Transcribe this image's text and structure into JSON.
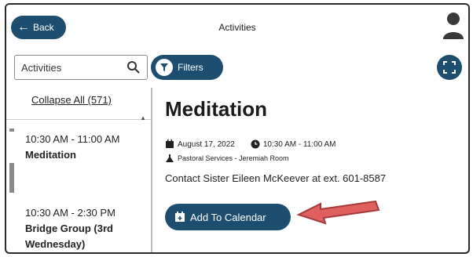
{
  "topbar": {
    "back_label": "Back",
    "title": "Activities"
  },
  "search": {
    "value": "Activities"
  },
  "filters": {
    "label": "Filters"
  },
  "list": {
    "collapse_label": "Collapse All (571)",
    "items": [
      {
        "time": "10:30 AM - 11:00 AM",
        "name": "Meditation"
      },
      {
        "time": "10:30 AM - 2:30 PM",
        "name": "Bridge Group (3rd Wednesday)"
      }
    ]
  },
  "detail": {
    "title": "Meditation",
    "date": "August 17, 2022",
    "time": "10:30 AM - 11:00 AM",
    "location": "Pastoral Services - Jeremiah Room",
    "contact": "Contact Sister Eileen McKeever at ext. 601-8587",
    "add_button": "Add To Calendar"
  },
  "colors": {
    "primary": "#1d4e6f",
    "annotation": "#e06060"
  },
  "icons": [
    "back-arrow-icon",
    "user-icon",
    "search-icon",
    "filter-icon",
    "expand-icon",
    "calendar-icon",
    "clock-icon",
    "location-icon",
    "calendar-plus-icon"
  ]
}
